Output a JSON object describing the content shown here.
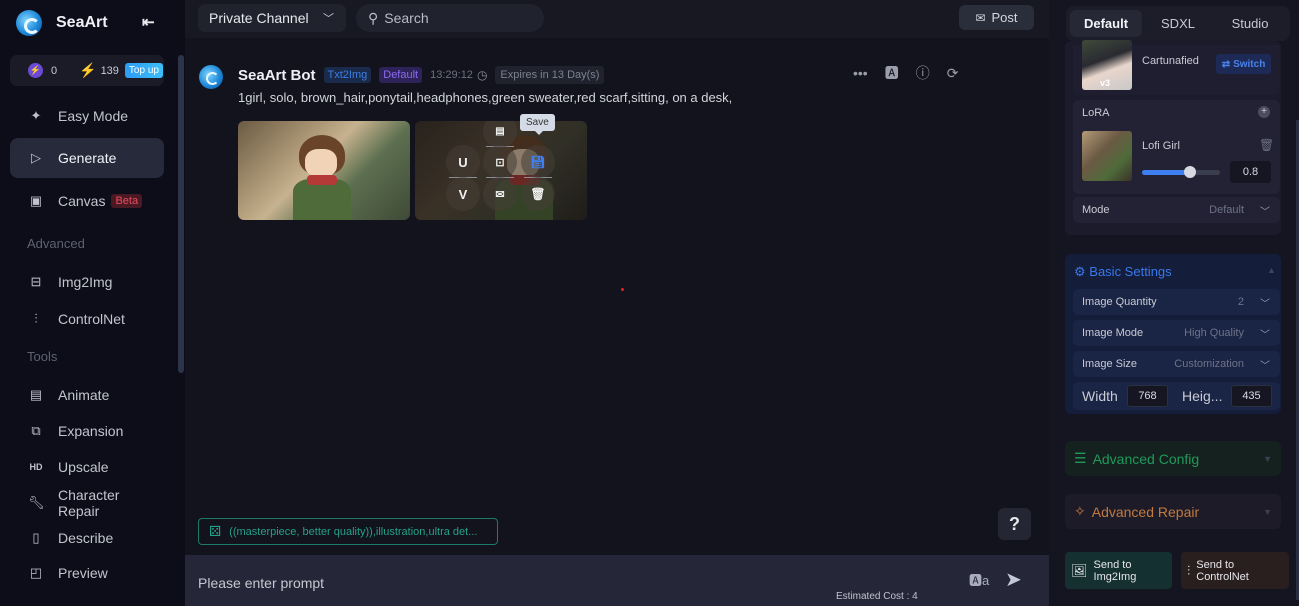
{
  "app": {
    "name": "SeaArt"
  },
  "credits": {
    "stamina": "0",
    "bolts": "139",
    "topup_label": "Top up"
  },
  "sidebar": {
    "primary": [
      {
        "label": "Easy Mode",
        "icon": "sparkle-icon"
      },
      {
        "label": "Generate",
        "icon": "play-icon",
        "active": true
      },
      {
        "label": "Canvas",
        "icon": "canvas-icon",
        "badge": "Beta"
      }
    ],
    "advanced_heading": "Advanced",
    "advanced": [
      {
        "label": "Img2Img",
        "icon": "image-icon"
      },
      {
        "label": "ControlNet",
        "icon": "sliders-icon"
      }
    ],
    "tools_heading": "Tools",
    "tools": [
      {
        "label": "Animate",
        "icon": "gif-icon"
      },
      {
        "label": "Expansion",
        "icon": "expand-icon"
      },
      {
        "label": "Upscale",
        "icon": "hd-icon"
      },
      {
        "label": "Character Repair",
        "icon": "wrench-sparkle-icon"
      },
      {
        "label": "Describe",
        "icon": "book-icon"
      },
      {
        "label": "Preview",
        "icon": "preview-icon"
      }
    ]
  },
  "topbar": {
    "channel": "Private Channel",
    "search_placeholder": "Search",
    "post_label": "Post"
  },
  "message": {
    "bot_name": "SeaArt Bot",
    "tag_type": "Txt2Img",
    "tag_mode": "Default",
    "time": "13:29:12",
    "expires": "Expires in 13 Day(s)",
    "prompt": "1girl, solo, brown_hair,ponytail,headphones,green sweater,red scarf,sitting, on a desk,",
    "overlay_buttons": {
      "upscale": "U",
      "variation": "V"
    },
    "tooltip": "Save"
  },
  "suggestion_chip": "((masterpiece, better quality)),illustration,ultra det...",
  "help_label": "?",
  "prompt_bar": {
    "placeholder": "Please enter prompt",
    "estimated_cost": "Estimated Cost : 4"
  },
  "right_panel": {
    "tabs": [
      {
        "label": "Default",
        "active": true
      },
      {
        "label": "SDXL"
      },
      {
        "label": "Studio"
      }
    ],
    "model": {
      "name": "Cartunafied",
      "version": "v3",
      "switch_label": "Switch"
    },
    "lora": {
      "label": "LoRA",
      "name": "Lofi Girl",
      "weight": "0.8",
      "weight_fraction": 0.62
    },
    "mode": {
      "label": "Mode",
      "value": "Default"
    },
    "basic_settings": {
      "title": "Basic Settings",
      "rows": [
        {
          "label": "Image Quantity",
          "value": "2"
        },
        {
          "label": "Image Mode",
          "value": "High Quality"
        },
        {
          "label": "Image Size",
          "value": "Customization"
        }
      ],
      "width_label": "Width",
      "width": "768",
      "height_label": "Heig...",
      "height": "435"
    },
    "advanced_config": "Advanced Config",
    "advanced_repair": "Advanced Repair",
    "send_img2img": [
      "Send to",
      "Img2Img"
    ],
    "send_controlnet": [
      "Send to",
      "ControlNet"
    ]
  }
}
